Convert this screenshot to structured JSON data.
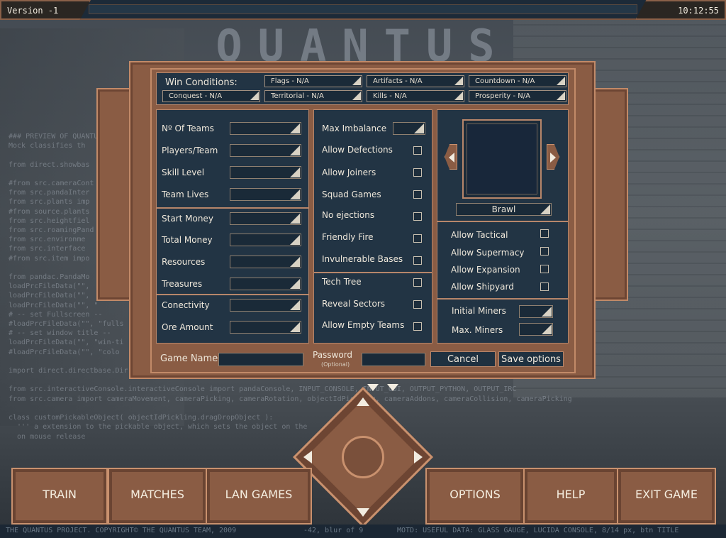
{
  "topbar": {
    "version": "Version -1",
    "clock": "10:12:55"
  },
  "background": {
    "logo": "QUANTUS",
    "code_lines": [
      "### PREVIEW OF QUANTUS",
      "Mock classifies th",
      "",
      "from direct.showbas",
      "",
      "#from src.cameraCont",
      "from src.pandaInter",
      "from src.plants imp",
      "#from source.plants",
      "from src.heightfiel",
      "from src.roamingPand",
      "from src.environme",
      "from src.interface",
      "#from src.item impo",
      "",
      "from pandac.PandaMo",
      "loadPrcFileData(\"\",",
      "loadPrcFileData(\"\",",
      "loadPrcFileData(\"\", \"",
      "# -- set Fullscreen --",
      "#loadPrcFileData(\"\", \"fulls",
      "# -- set window title --",
      "loadPrcFileData(\"\", \"win-ti",
      "#loadPrcFileData(\"\", \"colo",
      "",
      "import direct.directbase.Dir",
      "",
      "from src.interactiveConsole.interactiveConsole import pandaConsole, INPUT_CONSOLE, INPUT_GUI, OUTPUT_PYTHON, OUTPUT_IRC",
      "from src.camera import cameraMovement, cameraPicking, cameraRotation, objectIdPickling, cameraAddons, cameraCollision, cameraPicking",
      "",
      "class customPickableObject( objectIdPickling.dragDropObject ):",
      "  ''' a extension to the pickable object, which sets the object on the",
      "  on mouse release"
    ]
  },
  "win_conditions": {
    "title": "Win Conditions:",
    "items": [
      {
        "label": "Flags - N/A"
      },
      {
        "label": "Artifacts - N/A"
      },
      {
        "label": "Countdown - N/A"
      },
      {
        "label": "Conquest - N/A"
      },
      {
        "label": "Territorial - N/A"
      },
      {
        "label": "Kills - N/A"
      },
      {
        "label": "Prosperity - N/A"
      }
    ]
  },
  "left_settings": {
    "group1": [
      "Nº Of Teams",
      "Players/Team",
      "Skill Level",
      "Team Lives"
    ],
    "group2": [
      "Start Money",
      "Total Money",
      "Resources",
      "Treasures"
    ],
    "group3": [
      "Conectivity",
      "Ore Amount"
    ]
  },
  "middle_settings": {
    "max_imbalance": "Max Imbalance",
    "group1": [
      "Allow Defections",
      "Allow Joiners",
      "Squad Games",
      "No ejections",
      "Friendly Fire",
      "Invulnerable Bases"
    ],
    "group2": [
      "Tech Tree",
      "Reveal Sectors",
      "Allow Empty Teams"
    ]
  },
  "map": {
    "selected": "Brawl"
  },
  "right_settings": {
    "allow": [
      "Allow Tactical",
      "Allow Supermacy",
      "Allow Expansion",
      "Allow Shipyard"
    ],
    "miners": [
      "Initial Miners",
      "Max. Miners"
    ]
  },
  "bottom_row": {
    "game_name_label": "Game Name",
    "password_label": "Password",
    "password_hint": "(Optional)",
    "cancel": "Cancel",
    "save": "Save options"
  },
  "main_menu": [
    "TRAIN",
    "MATCHES",
    "LAN GAMES",
    "OPTIONS",
    "HELP",
    "EXIT GAME"
  ],
  "footer": {
    "copyright": "THE QUANTUS PROJECT. COPYRIGHT© THE QUANTUS TEAM, 2009",
    "blur": "-42, blur of 9",
    "motd": "MOTD: USEFUL DATA: GLASS GAUGE, LUCIDA CONSOLE, 8/14 px, btn TITLE"
  },
  "colors": {
    "copper": "#8a5c44",
    "copper_light": "#c28a68",
    "panel": "#223444",
    "text": "#eee7da"
  }
}
